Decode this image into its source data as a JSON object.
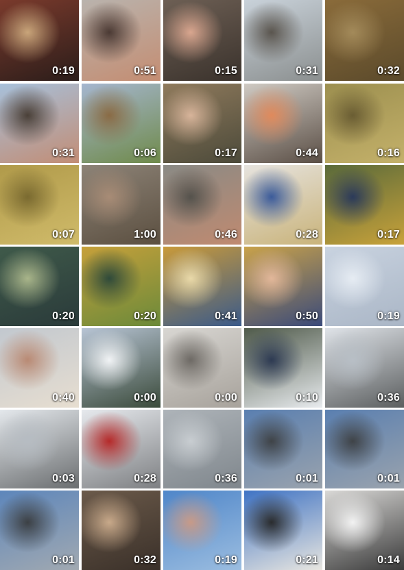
{
  "gallery": {
    "columns": 5,
    "items": [
      {
        "duration": "0:19",
        "subject": "restaurant interior",
        "colors": [
          "#7a3a2c",
          "#2b1d1a",
          "#c9a57a"
        ]
      },
      {
        "duration": "0:51",
        "subject": "woman selfie indoors",
        "colors": [
          "#b9b3ad",
          "#c48d72",
          "#4b3a34"
        ]
      },
      {
        "duration": "0:15",
        "subject": "tabby cat",
        "colors": [
          "#6d5f54",
          "#3a322c",
          "#d9a68f"
        ]
      },
      {
        "duration": "0:31",
        "subject": "woman selfie in forest",
        "colors": [
          "#c9d2da",
          "#8b8f8f",
          "#5a554e"
        ]
      },
      {
        "duration": "0:32",
        "subject": "autumn forest path",
        "colors": [
          "#8a6b3a",
          "#5b4a2b",
          "#a38a5a"
        ]
      },
      {
        "duration": "0:31",
        "subject": "woman selfie by castle",
        "colors": [
          "#a7c0da",
          "#c28d75",
          "#4a4038"
        ]
      },
      {
        "duration": "0:06",
        "subject": "valley landscape",
        "colors": [
          "#a5b6cf",
          "#6f8a4a",
          "#8a6b45"
        ]
      },
      {
        "duration": "0:17",
        "subject": "woman selfie on hillside",
        "colors": [
          "#8f7a5c",
          "#4c4a3a",
          "#d7b49a"
        ]
      },
      {
        "duration": "0:44",
        "subject": "woman selfie indoors",
        "colors": [
          "#cfcac3",
          "#5a4e45",
          "#e08a5c"
        ]
      },
      {
        "duration": "0:16",
        "subject": "pot of soup",
        "colors": [
          "#9c8f4f",
          "#c4b16a",
          "#6a5d33"
        ]
      },
      {
        "duration": "0:07",
        "subject": "pot of soup",
        "colors": [
          "#b09a4a",
          "#d0bb6a",
          "#7a6a30"
        ]
      },
      {
        "duration": "1:00",
        "subject": "forest trees",
        "colors": [
          "#8d8377",
          "#5b4f40",
          "#a88c76"
        ]
      },
      {
        "duration": "0:46",
        "subject": "woman selfie in scarf",
        "colors": [
          "#8a8a85",
          "#c08a70",
          "#55524c"
        ]
      },
      {
        "duration": "0:28",
        "subject": "museum painting on wall",
        "colors": [
          "#e6e3de",
          "#c9b37a",
          "#3b5b9a"
        ]
      },
      {
        "duration": "0:17",
        "subject": "painting detail",
        "colors": [
          "#5a6a3a",
          "#c8a23a",
          "#2b3a5a"
        ]
      },
      {
        "duration": "0:20",
        "subject": "painting detail water lilies",
        "colors": [
          "#3f5a4a",
          "#2a3a3a",
          "#a9b58a"
        ]
      },
      {
        "duration": "0:20",
        "subject": "painting wheat field",
        "colors": [
          "#c6a03a",
          "#6b8a3a",
          "#2f4a3a"
        ]
      },
      {
        "duration": "0:41",
        "subject": "painting with yellow and blue",
        "colors": [
          "#c99a3a",
          "#3a5a8a",
          "#e9d9a9"
        ]
      },
      {
        "duration": "0:50",
        "subject": "hand pointing at painting",
        "colors": [
          "#c9a24a",
          "#3a4a7a",
          "#e2b79a"
        ]
      },
      {
        "duration": "0:19",
        "subject": "snow with tracks",
        "colors": [
          "#c9d3e0",
          "#aab6c6",
          "#e6ecf3"
        ]
      },
      {
        "duration": "0:40",
        "subject": "woman selfie in snow",
        "colors": [
          "#c2c8cf",
          "#e7ded0",
          "#b98a74"
        ]
      },
      {
        "duration": "0:00",
        "subject": "snowy lake shore",
        "colors": [
          "#b7c4d4",
          "#3a4a3a",
          "#f1f3f5"
        ]
      },
      {
        "duration": "0:00",
        "subject": "ice pattern",
        "colors": [
          "#d8d6d2",
          "#a7a29b",
          "#6e6a65"
        ]
      },
      {
        "duration": "0:10",
        "subject": "person in snow",
        "colors": [
          "#4f5a4a",
          "#e8ebee",
          "#2d3a52"
        ]
      },
      {
        "duration": "0:36",
        "subject": "snowy forest path",
        "colors": [
          "#dfe3e8",
          "#5b5e5f",
          "#b8bfc6"
        ]
      },
      {
        "duration": "0:03",
        "subject": "snowy forest",
        "colors": [
          "#e4e8ec",
          "#6a6d6f",
          "#b6bcc2"
        ]
      },
      {
        "duration": "0:28",
        "subject": "person walking in snow",
        "colors": [
          "#e6e9ed",
          "#7d7f82",
          "#b52a2a"
        ]
      },
      {
        "duration": "0:36",
        "subject": "frozen ice surface",
        "colors": [
          "#aeb4b9",
          "#7f868c",
          "#c8cdd1"
        ]
      },
      {
        "duration": "0:01",
        "subject": "frozen lake with shadow",
        "colors": [
          "#5a7fb0",
          "#9aa3ad",
          "#3f4347"
        ]
      },
      {
        "duration": "0:01",
        "subject": "frozen lake with shadow",
        "colors": [
          "#5a7fb0",
          "#9aa3ad",
          "#3f4347"
        ]
      },
      {
        "duration": "0:01",
        "subject": "frozen lake with shadow",
        "colors": [
          "#5d86bb",
          "#a1a9b1",
          "#3c4044"
        ]
      },
      {
        "duration": "0:32",
        "subject": "tabby cat",
        "colors": [
          "#6b5a4a",
          "#3a3029",
          "#c8a98a"
        ]
      },
      {
        "duration": "0:19",
        "subject": "sky selfie with trees",
        "colors": [
          "#4f86c9",
          "#9bbde0",
          "#c79a88"
        ]
      },
      {
        "duration": "0:21",
        "subject": "birch trees and sky",
        "colors": [
          "#3f73c4",
          "#e8e6e0",
          "#2a2c2e"
        ]
      },
      {
        "duration": "0:14",
        "subject": "white hanging lamps",
        "colors": [
          "#d9d8d6",
          "#3a3a3a",
          "#f2f2f2"
        ]
      }
    ]
  }
}
